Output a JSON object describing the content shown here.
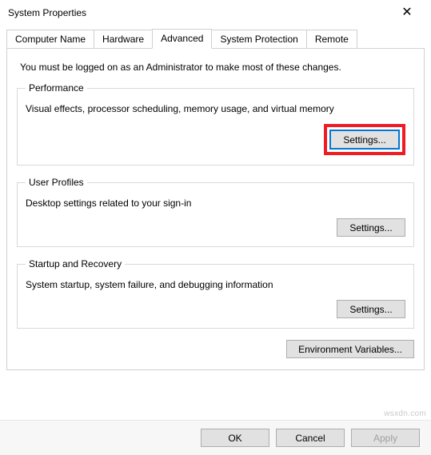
{
  "window": {
    "title": "System Properties",
    "close_glyph": "✕"
  },
  "tabs": {
    "computer_name": "Computer Name",
    "hardware": "Hardware",
    "advanced": "Advanced",
    "system_protection": "System Protection",
    "remote": "Remote"
  },
  "advanced_panel": {
    "intro": "You must be logged on as an Administrator to make most of these changes.",
    "performance": {
      "legend": "Performance",
      "desc": "Visual effects, processor scheduling, memory usage, and virtual memory",
      "settings_label": "Settings..."
    },
    "user_profiles": {
      "legend": "User Profiles",
      "desc": "Desktop settings related to your sign-in",
      "settings_label": "Settings..."
    },
    "startup_recovery": {
      "legend": "Startup and Recovery",
      "desc": "System startup, system failure, and debugging information",
      "settings_label": "Settings..."
    },
    "env_vars_label": "Environment Variables..."
  },
  "footer": {
    "ok": "OK",
    "cancel": "Cancel",
    "apply": "Apply"
  },
  "watermark": "wsxdn.com"
}
